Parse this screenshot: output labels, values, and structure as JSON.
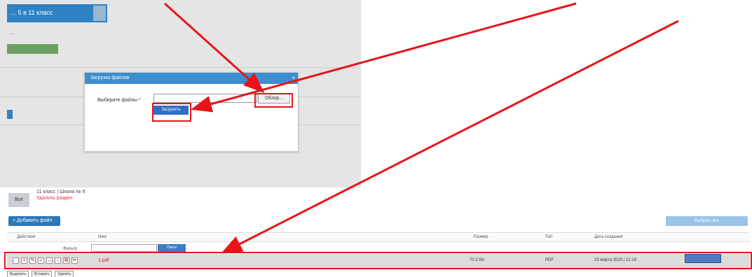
{
  "upper": {
    "course_title": "… 5 в 11 класс",
    "red_link": "…",
    "dialog": {
      "title": "Загрузка файлов",
      "close": "×",
      "select_label": "Выберите файлы *",
      "browse_label": "Обзор...",
      "upload_label": "Загрузить"
    }
  },
  "lower": {
    "info_box": "Все",
    "info_lines": [
      "11 класс | Школа № 6"
    ],
    "info_danger": "Удалить раздел",
    "add_file_button": "+ Добавить файл",
    "select_all_button": "Выбрать все",
    "columns": [
      "Действия",
      "Имя",
      "Размер",
      "Тип",
      "Дата создания"
    ],
    "filter_label": "Фильтр",
    "filter_button": "Поиск",
    "file": {
      "name": "1.pdf",
      "size": "70.3 Kb",
      "type": "PDF",
      "date": "23 марта 2020 | 12:19"
    },
    "bottom_buttons": [
      "Выделить",
      "Вставить",
      "Удалить"
    ]
  },
  "colors": {
    "highlight": "#e8141a",
    "accent": "#2f83c4"
  }
}
